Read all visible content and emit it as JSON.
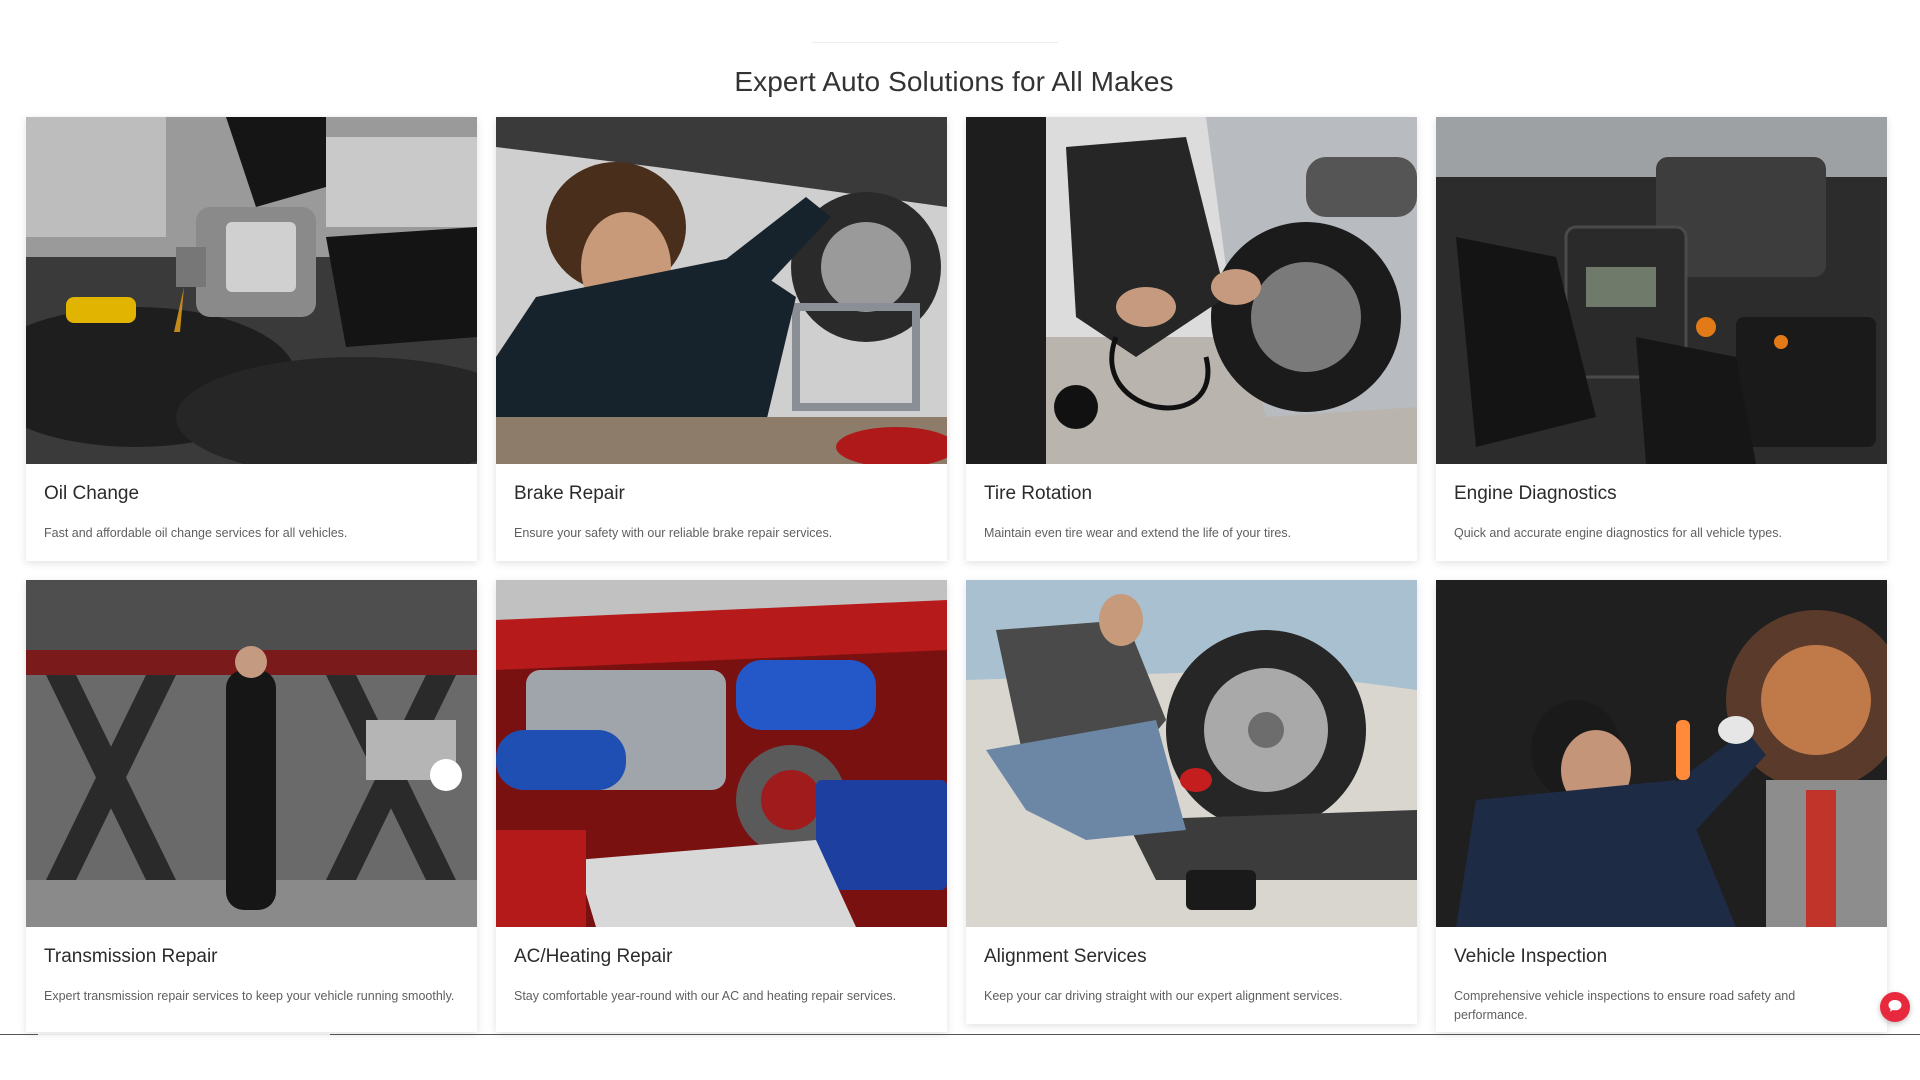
{
  "section": {
    "title": "Expert Auto Solutions for All Makes"
  },
  "services": [
    {
      "title": "Oil Change",
      "description": "Fast and affordable oil change services for all vehicles.",
      "image": "mechanic-pouring-oil-photo"
    },
    {
      "title": "Brake Repair",
      "description": "Ensure your safety with our reliable brake repair services.",
      "image": "mechanic-under-car-brake-photo"
    },
    {
      "title": "Tire Rotation",
      "description": "Maintain even tire wear and extend the life of your tires.",
      "image": "mechanic-inflating-tire-photo"
    },
    {
      "title": "Engine Diagnostics",
      "description": "Quick and accurate engine diagnostics for all vehicle types.",
      "image": "engine-diagnostic-tool-photo"
    },
    {
      "title": "Transmission Repair",
      "description": "Expert transmission repair services to keep your vehicle running smoothly.",
      "image": "mechanic-under-lifted-car-photo"
    },
    {
      "title": "AC/Heating Repair",
      "description": "Stay comfortable year-round with our AC and heating repair services.",
      "image": "engine-bay-blue-hoses-photo"
    },
    {
      "title": "Alignment Services",
      "description": "Keep your car driving straight with our expert alignment services.",
      "image": "mechanic-wheel-alignment-photo"
    },
    {
      "title": "Vehicle Inspection",
      "description": "Comprehensive vehicle inspections to ensure road safety and performance.",
      "image": "mechanic-inspecting-undercarriage-photo"
    }
  ],
  "chat": {
    "icon": "chat-bubble-icon"
  },
  "colors": {
    "accent": "#e8283d",
    "title": "#333333",
    "text": "#5f5f5f"
  }
}
